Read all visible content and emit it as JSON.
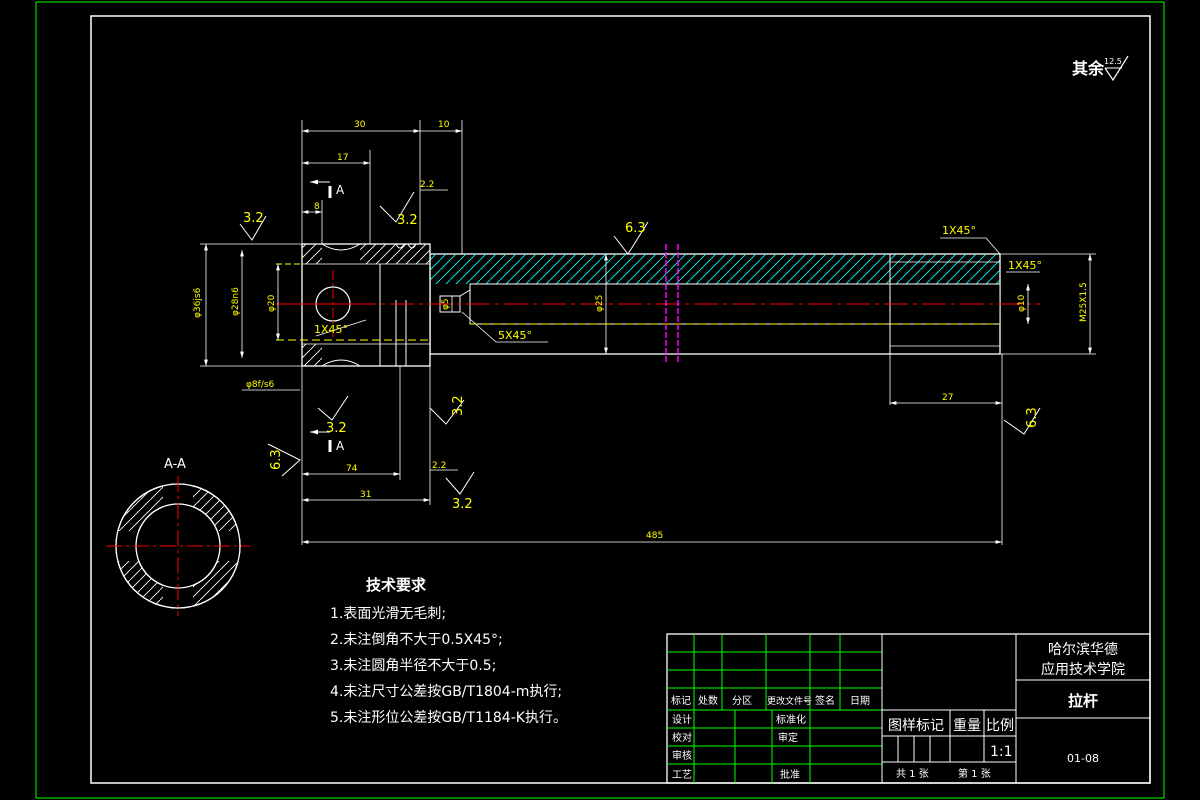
{
  "title_block": {
    "institution_line1": "哈尔滨华德",
    "institution_line2": "应用技术学院",
    "part_name": "拉杆",
    "drawing_number": "01-08",
    "scale": "1:1",
    "headers": [
      "标记",
      "处数",
      "分区",
      "更改文件号",
      "签名",
      "日期"
    ],
    "row_labels": [
      "设计",
      "校对",
      "审核",
      "工艺"
    ],
    "mid_labels": [
      "标准化",
      "审定",
      "批准"
    ],
    "stage_mark_label": "图样标记",
    "weight_label": "重量",
    "scale_label": "比例",
    "sheet_total": "共 1 张",
    "sheet_index": "第 1 张"
  },
  "notes": {
    "heading": "技术要求",
    "items": [
      "1.表面光滑无毛刺;",
      "2.未注倒角不大于0.5X45°;",
      "3.未注圆角半径不大于0.5;",
      "4.未注尺寸公差按GB/T1804-m执行;",
      "5.未注形位公差按GB/T1184-K执行。"
    ]
  },
  "roughness_note": {
    "prefix": "其余",
    "value": "12.5"
  },
  "section": {
    "label": "A-A",
    "cut_mark": "A"
  },
  "dimensions": {
    "d30": "30",
    "d10": "10",
    "d17": "17",
    "d8": "8",
    "d74": "74",
    "d31": "31",
    "d485": "485",
    "d27": "27",
    "dia36": "φ36js6",
    "dia28": "φ28n6",
    "dia20": "φ20",
    "dia25": "φ25",
    "dia5": "φ5",
    "dia10": "φ10",
    "thread": "M25X1.5",
    "dia_bottom": "φ8f/s6",
    "groove1": "2.2",
    "groove2": "2.2"
  },
  "chamfers": {
    "c1": "1X45°",
    "c2": "1X45°",
    "c3": "5X45°",
    "c4": "1X45°"
  },
  "roughness_marks": {
    "r1": "3.2",
    "r2": "3.2",
    "r3": "3.2",
    "r4": "3.2",
    "r5": "3.2",
    "r6": "6.3",
    "r7": "6.3",
    "r8": "6.3"
  }
}
